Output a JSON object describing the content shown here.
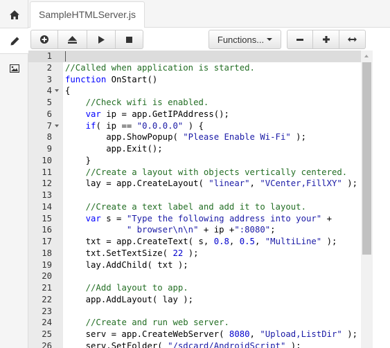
{
  "sidebar": {
    "items": [
      {
        "name": "home-icon",
        "active": false
      },
      {
        "name": "pencil-icon",
        "active": true
      },
      {
        "name": "image-icon",
        "active": false
      }
    ]
  },
  "tabs": [
    {
      "label": "SampleHTMLServer.js",
      "active": true
    }
  ],
  "toolbar": {
    "buttons": [
      "add-icon",
      "eject-icon",
      "play-icon",
      "stop-icon"
    ],
    "functions_label": "Functions...",
    "zoom_buttons": [
      "minus-icon",
      "plus-icon",
      "expand-horizontal-icon"
    ]
  },
  "editor": {
    "language": "javascript",
    "cursor_line": 1,
    "lines": [
      {
        "n": "1",
        "text": ""
      },
      {
        "n": "2",
        "text": "//Called when application is started."
      },
      {
        "n": "3",
        "text": "function OnStart()"
      },
      {
        "n": "4",
        "text": "{"
      },
      {
        "n": "5",
        "text": "    //Check wifi is enabled."
      },
      {
        "n": "6",
        "text": "    var ip = app.GetIPAddress();"
      },
      {
        "n": "7",
        "text": "    if( ip == \"0.0.0.0\" ) {"
      },
      {
        "n": "8",
        "text": "        app.ShowPopup( \"Please Enable Wi-Fi\" );"
      },
      {
        "n": "9",
        "text": "        app.Exit();"
      },
      {
        "n": "10",
        "text": "    }"
      },
      {
        "n": "11",
        "text": "    //Create a layout with objects vertically centered."
      },
      {
        "n": "12",
        "text": "    lay = app.CreateLayout( \"linear\", \"VCenter,FillXY\" );"
      },
      {
        "n": "13",
        "text": ""
      },
      {
        "n": "14",
        "text": "    //Create a text label and add it to layout."
      },
      {
        "n": "15",
        "text": "    var s = \"Type the following address into your\" +"
      },
      {
        "n": "16",
        "text": "            \" browser\\n\\n\" + ip +\":8080\";"
      },
      {
        "n": "17",
        "text": "    txt = app.CreateText( s, 0.8, 0.5, \"MultiLine\" );"
      },
      {
        "n": "18",
        "text": "    txt.SetTextSize( 22 );"
      },
      {
        "n": "19",
        "text": "    lay.AddChild( txt );"
      },
      {
        "n": "20",
        "text": ""
      },
      {
        "n": "21",
        "text": "    //Add layout to app."
      },
      {
        "n": "22",
        "text": "    app.AddLayout( lay );"
      },
      {
        "n": "23",
        "text": ""
      },
      {
        "n": "24",
        "text": "    //Create and run web server."
      },
      {
        "n": "25",
        "text": "    serv = app.CreateWebServer( 8080, \"Upload,ListDir\" );"
      },
      {
        "n": "26",
        "text": "    serv.SetFolder( \"/sdcard/AndroidScript\" );"
      }
    ],
    "fold_lines": [
      "4",
      "7"
    ]
  },
  "colors": {
    "comment": "#236e24",
    "keyword": "#0000ff",
    "string": "#1a1aa6",
    "number": "#0000cd",
    "gutter": "#ebebeb",
    "active_line": "#dcdcdc"
  }
}
